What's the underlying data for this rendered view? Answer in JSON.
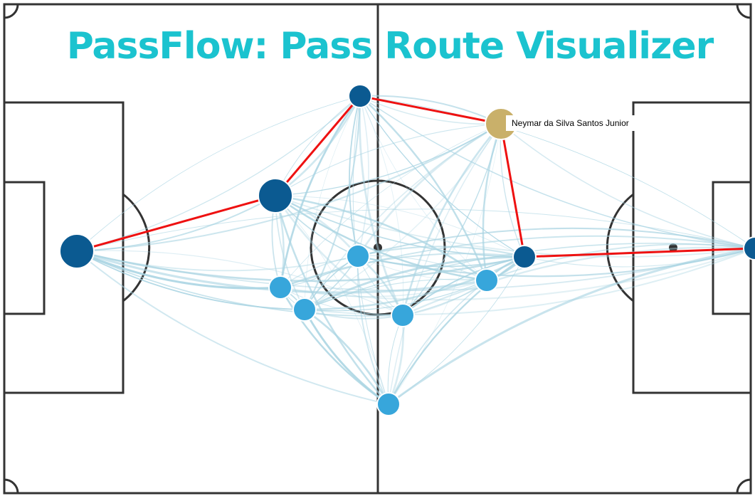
{
  "title": "PassFlow: Pass Route Visualizer",
  "tooltip": {
    "player_name": "Neymar da Silva Santos Junior"
  },
  "colors": {
    "pitch_line": "#333333",
    "title": "#1bc3cf",
    "pass_edge": "#a9d4e2",
    "route": "#ee1111",
    "node_dark": "#0b5a91",
    "node_light": "#37a6db",
    "node_selected": "#c9b06a"
  },
  "players": [
    {
      "id": "p1",
      "tone": "dark",
      "selected": false
    },
    {
      "id": "p2",
      "tone": "dark",
      "selected": false
    },
    {
      "id": "p3",
      "tone": "dark",
      "selected": false
    },
    {
      "id": "p4",
      "tone": "gold",
      "selected": true
    },
    {
      "id": "p5",
      "tone": "dark",
      "selected": false
    },
    {
      "id": "p6",
      "tone": "dark",
      "selected": false
    },
    {
      "id": "p7",
      "tone": "light",
      "selected": false
    },
    {
      "id": "p8",
      "tone": "light",
      "selected": false
    },
    {
      "id": "p9",
      "tone": "light",
      "selected": false
    },
    {
      "id": "p10",
      "tone": "light",
      "selected": false
    },
    {
      "id": "p11",
      "tone": "light",
      "selected": false
    },
    {
      "id": "p12",
      "tone": "light",
      "selected": false
    }
  ],
  "pass_route": [
    "p1",
    "p2",
    "p3",
    "p4",
    "p5",
    "p6"
  ]
}
